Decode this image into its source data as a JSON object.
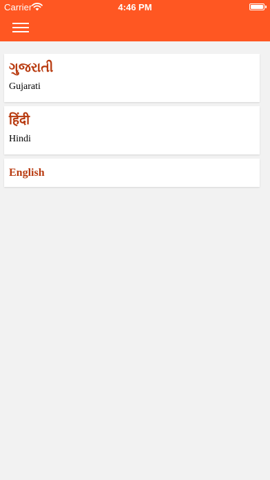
{
  "status_bar": {
    "carrier": "Carrier",
    "time": "4:46 PM",
    "battery_level": 1.0
  },
  "header": {
    "menu_icon": "hamburger-menu-icon",
    "color": "#ff5722"
  },
  "languages": [
    {
      "native": "ગુજરાતી",
      "english": "Gujarati"
    },
    {
      "native": "हिंदी",
      "english": "Hindi"
    },
    {
      "native": "English"
    }
  ],
  "colors": {
    "accent_text": "#b83a0f",
    "background": "#f2f2f2"
  }
}
